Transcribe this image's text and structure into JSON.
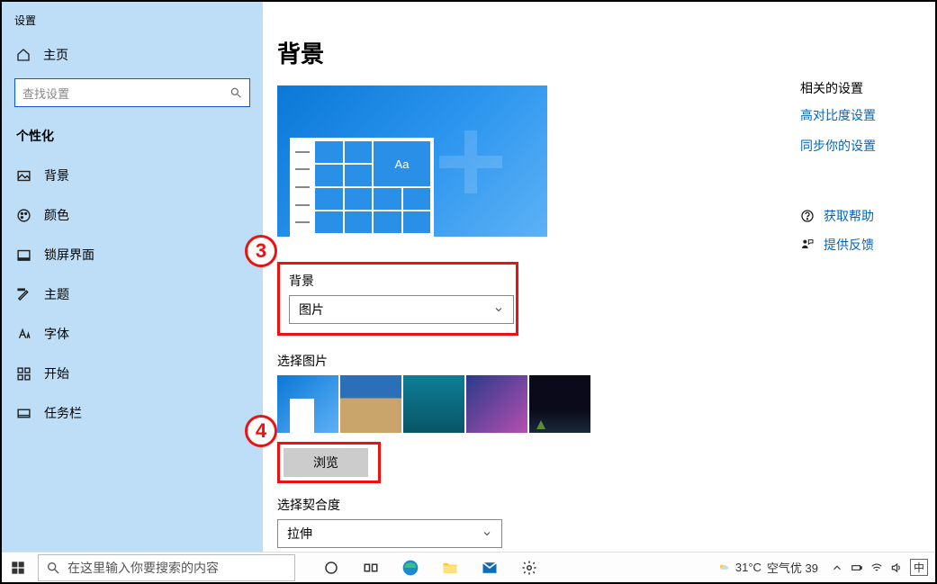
{
  "window": {
    "title": "设置"
  },
  "sidebar": {
    "home": "主页",
    "search_placeholder": "查找设置",
    "category": "个性化",
    "items": [
      {
        "label": "背景"
      },
      {
        "label": "颜色"
      },
      {
        "label": "锁屏界面"
      },
      {
        "label": "主题"
      },
      {
        "label": "字体"
      },
      {
        "label": "开始"
      },
      {
        "label": "任务栏"
      }
    ]
  },
  "page": {
    "title": "背景",
    "preview_aa": "Aa",
    "bg_section_label": "背景",
    "bg_dropdown_value": "图片",
    "choose_picture_label": "选择图片",
    "browse_button": "浏览",
    "fit_label": "选择契合度",
    "fit_dropdown_value": "拉伸"
  },
  "annotations": {
    "step3": "3",
    "step4": "4"
  },
  "related": {
    "header": "相关的设置",
    "links": [
      "高对比度设置",
      "同步你的设置"
    ],
    "get_help": "获取帮助",
    "feedback": "提供反馈"
  },
  "taskbar": {
    "search_placeholder": "在这里输入你要搜索的内容",
    "weather_temp": "31°C",
    "weather_text": "空气优 39",
    "ime": "中"
  }
}
